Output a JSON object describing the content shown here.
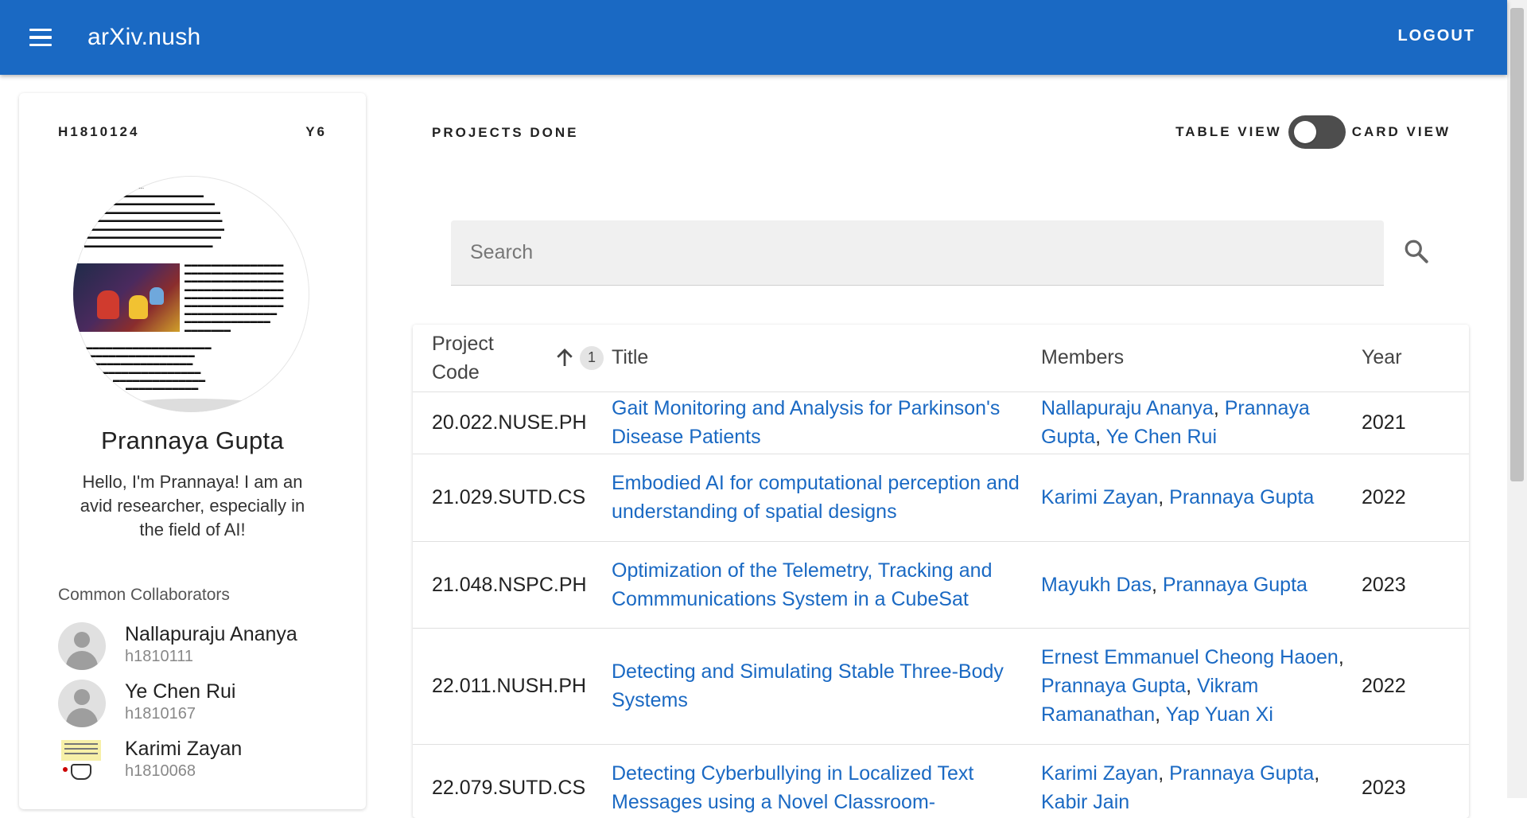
{
  "app": {
    "title": "arXiv.nush",
    "logout_label": "LOGOUT"
  },
  "profile": {
    "id": "H1810124",
    "year": "Y6",
    "name": "Prannaya Gupta",
    "bio": "Hello, I'm Prannaya! I am an avid researcher, especially in the field of AI!",
    "collaborators_title": "Common Collaborators",
    "collaborators": [
      {
        "name": "Nallapuraju Ananya",
        "id": "h1810111"
      },
      {
        "name": "Ye Chen Rui",
        "id": "h1810167"
      },
      {
        "name": "Karimi Zayan",
        "id": "h1810068"
      }
    ]
  },
  "main": {
    "projects_title": "PROJECTS DONE",
    "table_view_label": "TABLE VIEW",
    "card_view_label": "CARD VIEW",
    "search_placeholder": "Search",
    "sort_badge": "1",
    "columns": [
      "Project Code",
      "Title",
      "Members",
      "Year"
    ],
    "rows": [
      {
        "code": "20.022.NUSE.PH",
        "title": "Gait Monitoring and Analysis for Parkinson's Disease Patients",
        "members": [
          "Nallapuraju Ananya",
          "Prannaya Gupta",
          "Ye Chen Rui"
        ],
        "year": "2021"
      },
      {
        "code": "21.029.SUTD.CS",
        "title": "Embodied AI for computational perception and understanding of spatial designs",
        "members": [
          "Karimi Zayan",
          "Prannaya Gupta"
        ],
        "year": "2022"
      },
      {
        "code": "21.048.NSPC.PH",
        "title": "Optimization of the Telemetry, Tracking and Commmunications System in a CubeSat",
        "members": [
          "Mayukh Das",
          "Prannaya Gupta"
        ],
        "year": "2023"
      },
      {
        "code": "22.011.NUSH.PH",
        "title": "Detecting and Simulating Stable Three-Body Systems",
        "members": [
          "Ernest Emmanuel Cheong Haoen",
          "Prannaya Gupta",
          "Vikram Ramanathan",
          "Yap Yuan Xi"
        ],
        "year": "2022"
      },
      {
        "code": "22.079.SUTD.CS",
        "title": "Detecting Cyberbullying in Localized Text Messages using a Novel Classroom-",
        "members": [
          "Karimi Zayan",
          "Prannaya Gupta",
          "Kabir Jain"
        ],
        "year": "2023"
      }
    ]
  }
}
